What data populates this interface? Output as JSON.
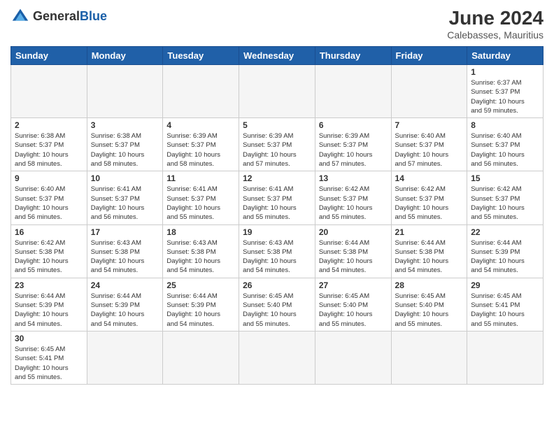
{
  "header": {
    "logo_general": "General",
    "logo_blue": "Blue",
    "month_year": "June 2024",
    "location": "Calebasses, Mauritius"
  },
  "weekdays": [
    "Sunday",
    "Monday",
    "Tuesday",
    "Wednesday",
    "Thursday",
    "Friday",
    "Saturday"
  ],
  "days": [
    {
      "date": "",
      "info": ""
    },
    {
      "date": "",
      "info": ""
    },
    {
      "date": "",
      "info": ""
    },
    {
      "date": "",
      "info": ""
    },
    {
      "date": "",
      "info": ""
    },
    {
      "date": "",
      "info": ""
    },
    {
      "date": "1",
      "info": "Sunrise: 6:37 AM\nSunset: 5:37 PM\nDaylight: 10 hours\nand 59 minutes."
    },
    {
      "date": "2",
      "info": "Sunrise: 6:38 AM\nSunset: 5:37 PM\nDaylight: 10 hours\nand 58 minutes."
    },
    {
      "date": "3",
      "info": "Sunrise: 6:38 AM\nSunset: 5:37 PM\nDaylight: 10 hours\nand 58 minutes."
    },
    {
      "date": "4",
      "info": "Sunrise: 6:39 AM\nSunset: 5:37 PM\nDaylight: 10 hours\nand 58 minutes."
    },
    {
      "date": "5",
      "info": "Sunrise: 6:39 AM\nSunset: 5:37 PM\nDaylight: 10 hours\nand 57 minutes."
    },
    {
      "date": "6",
      "info": "Sunrise: 6:39 AM\nSunset: 5:37 PM\nDaylight: 10 hours\nand 57 minutes."
    },
    {
      "date": "7",
      "info": "Sunrise: 6:40 AM\nSunset: 5:37 PM\nDaylight: 10 hours\nand 57 minutes."
    },
    {
      "date": "8",
      "info": "Sunrise: 6:40 AM\nSunset: 5:37 PM\nDaylight: 10 hours\nand 56 minutes."
    },
    {
      "date": "9",
      "info": "Sunrise: 6:40 AM\nSunset: 5:37 PM\nDaylight: 10 hours\nand 56 minutes."
    },
    {
      "date": "10",
      "info": "Sunrise: 6:41 AM\nSunset: 5:37 PM\nDaylight: 10 hours\nand 56 minutes."
    },
    {
      "date": "11",
      "info": "Sunrise: 6:41 AM\nSunset: 5:37 PM\nDaylight: 10 hours\nand 55 minutes."
    },
    {
      "date": "12",
      "info": "Sunrise: 6:41 AM\nSunset: 5:37 PM\nDaylight: 10 hours\nand 55 minutes."
    },
    {
      "date": "13",
      "info": "Sunrise: 6:42 AM\nSunset: 5:37 PM\nDaylight: 10 hours\nand 55 minutes."
    },
    {
      "date": "14",
      "info": "Sunrise: 6:42 AM\nSunset: 5:37 PM\nDaylight: 10 hours\nand 55 minutes."
    },
    {
      "date": "15",
      "info": "Sunrise: 6:42 AM\nSunset: 5:37 PM\nDaylight: 10 hours\nand 55 minutes."
    },
    {
      "date": "16",
      "info": "Sunrise: 6:42 AM\nSunset: 5:38 PM\nDaylight: 10 hours\nand 55 minutes."
    },
    {
      "date": "17",
      "info": "Sunrise: 6:43 AM\nSunset: 5:38 PM\nDaylight: 10 hours\nand 54 minutes."
    },
    {
      "date": "18",
      "info": "Sunrise: 6:43 AM\nSunset: 5:38 PM\nDaylight: 10 hours\nand 54 minutes."
    },
    {
      "date": "19",
      "info": "Sunrise: 6:43 AM\nSunset: 5:38 PM\nDaylight: 10 hours\nand 54 minutes."
    },
    {
      "date": "20",
      "info": "Sunrise: 6:44 AM\nSunset: 5:38 PM\nDaylight: 10 hours\nand 54 minutes."
    },
    {
      "date": "21",
      "info": "Sunrise: 6:44 AM\nSunset: 5:38 PM\nDaylight: 10 hours\nand 54 minutes."
    },
    {
      "date": "22",
      "info": "Sunrise: 6:44 AM\nSunset: 5:39 PM\nDaylight: 10 hours\nand 54 minutes."
    },
    {
      "date": "23",
      "info": "Sunrise: 6:44 AM\nSunset: 5:39 PM\nDaylight: 10 hours\nand 54 minutes."
    },
    {
      "date": "24",
      "info": "Sunrise: 6:44 AM\nSunset: 5:39 PM\nDaylight: 10 hours\nand 54 minutes."
    },
    {
      "date": "25",
      "info": "Sunrise: 6:44 AM\nSunset: 5:39 PM\nDaylight: 10 hours\nand 54 minutes."
    },
    {
      "date": "26",
      "info": "Sunrise: 6:45 AM\nSunset: 5:40 PM\nDaylight: 10 hours\nand 55 minutes."
    },
    {
      "date": "27",
      "info": "Sunrise: 6:45 AM\nSunset: 5:40 PM\nDaylight: 10 hours\nand 55 minutes."
    },
    {
      "date": "28",
      "info": "Sunrise: 6:45 AM\nSunset: 5:40 PM\nDaylight: 10 hours\nand 55 minutes."
    },
    {
      "date": "29",
      "info": "Sunrise: 6:45 AM\nSunset: 5:41 PM\nDaylight: 10 hours\nand 55 minutes."
    },
    {
      "date": "30",
      "info": "Sunrise: 6:45 AM\nSunset: 5:41 PM\nDaylight: 10 hours\nand 55 minutes."
    },
    {
      "date": "",
      "info": ""
    },
    {
      "date": "",
      "info": ""
    },
    {
      "date": "",
      "info": ""
    },
    {
      "date": "",
      "info": ""
    },
    {
      "date": "",
      "info": ""
    },
    {
      "date": "",
      "info": ""
    }
  ]
}
